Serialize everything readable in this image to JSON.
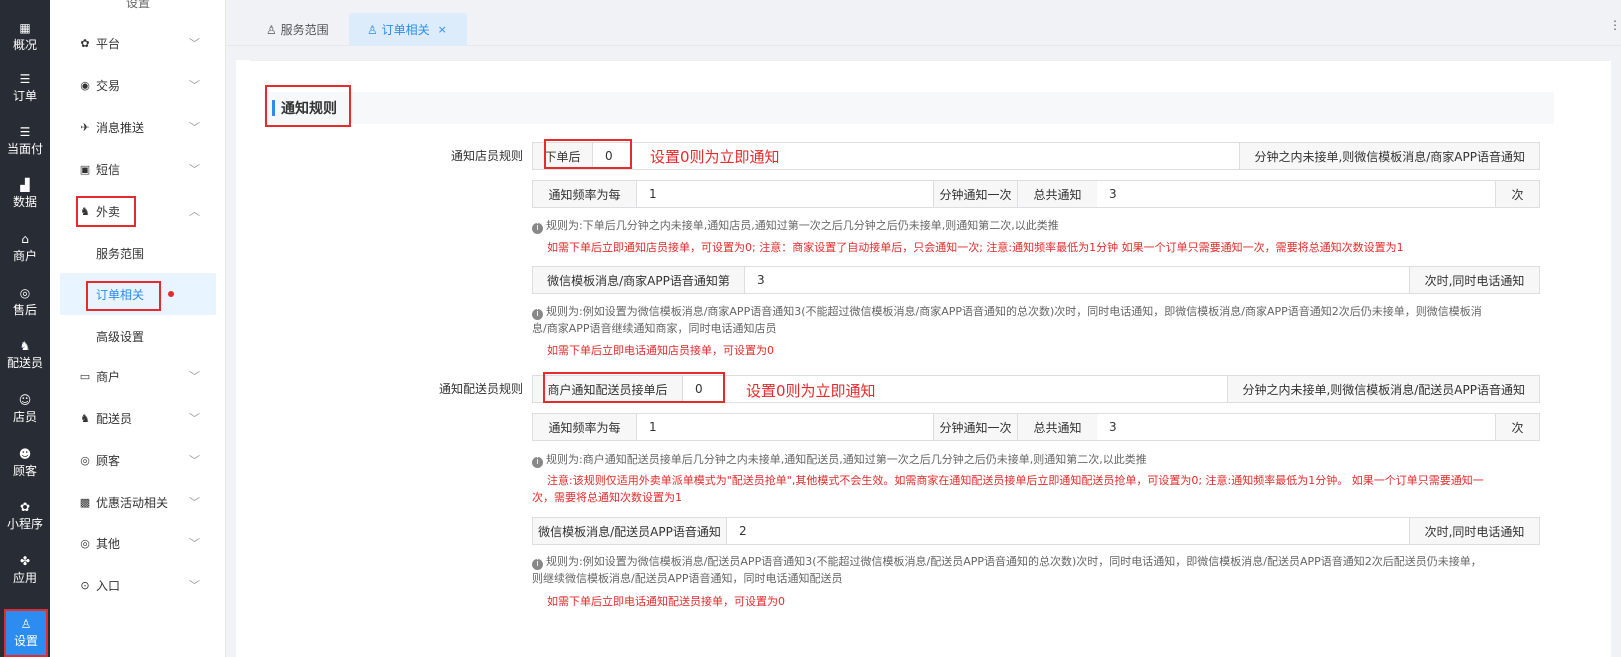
{
  "rail": [
    {
      "icon": "dashboard-icon",
      "glyph": "▦",
      "label": "概况"
    },
    {
      "icon": "list-icon",
      "glyph": "☰",
      "label": "订单"
    },
    {
      "icon": "list-icon",
      "glyph": "☰",
      "label": "当面付"
    },
    {
      "icon": "bar-chart-icon",
      "glyph": "▟",
      "label": "数据"
    },
    {
      "icon": "shop-icon",
      "glyph": "⌂",
      "label": "商户"
    },
    {
      "icon": "headset-icon",
      "glyph": "◎",
      "label": "售后"
    },
    {
      "icon": "scooter-icon",
      "glyph": "♞",
      "label": "配送员"
    },
    {
      "icon": "user-icon",
      "glyph": "☺",
      "label": "店员"
    },
    {
      "icon": "customer-icon",
      "glyph": "☻",
      "label": "顾客"
    },
    {
      "icon": "mini-program-icon",
      "glyph": "✿",
      "label": "小程序"
    },
    {
      "icon": "apps-icon",
      "glyph": "✤",
      "label": "应用"
    },
    {
      "icon": "settings-user-icon",
      "glyph": "♙",
      "label": "设置"
    }
  ],
  "submenu": {
    "title": "设置",
    "items": [
      {
        "icon": "gear-icon",
        "glyph": "✿",
        "label": "平台"
      },
      {
        "icon": "trade-icon",
        "glyph": "◉",
        "label": "交易"
      },
      {
        "icon": "push-icon",
        "glyph": "✈",
        "label": "消息推送"
      },
      {
        "icon": "sms-icon",
        "glyph": "▣",
        "label": "短信"
      },
      {
        "icon": "takeout-icon",
        "glyph": "♞",
        "label": "外卖"
      },
      {
        "icon": "shop-icon",
        "glyph": "▭",
        "label": "商户"
      },
      {
        "icon": "rider-icon",
        "glyph": "♞",
        "label": "配送员"
      },
      {
        "icon": "customer-icon",
        "glyph": "◎",
        "label": "顾客"
      },
      {
        "icon": "gift-icon",
        "glyph": "▩",
        "label": "优惠活动相关"
      },
      {
        "icon": "other-icon",
        "glyph": "◎",
        "label": "其他"
      },
      {
        "icon": "entry-icon",
        "glyph": "⊙",
        "label": "入口"
      }
    ],
    "subitems": [
      "服务范围",
      "订单相关",
      "高级设置"
    ]
  },
  "tabs": [
    {
      "label": "服务范围"
    },
    {
      "label": "订单相关",
      "close": "×"
    }
  ],
  "tabs_more": "⋮",
  "section_title": "通知规则",
  "store": {
    "label": "通知店员规则",
    "after_order": "下单后",
    "after_order_value": "0",
    "annotation": "设置0则为立即通知",
    "after_order_suffix": "分钟之内未接单,则微信模板消息/商家APP语音通知",
    "freq_label": "通知频率为每",
    "freq_value": "1",
    "freq_unit": "分钟通知一次",
    "total_label": "总共通知",
    "total_value": "3",
    "total_unit": "次",
    "rule_note": "规则为:下单后几分钟之内未接单,通知店员,通知过第一次之后几分钟之后仍未接单,则通知第二次,以此类推",
    "warn": "如需下单后立即通知店员接单，可设置为0; 注意：商家设置了自动接单后，只会通知一次; 注意:通知频率最低为1分钟 如果一个订单只需要通知一次，需要将总通知次数设置为1",
    "wx_label": "微信模板消息/商家APP语音通知第",
    "wx_value": "3",
    "wx_unit": "次时,同时电话通知",
    "wx_note_1": "规则为:例如设置为微信模板消息/商家APP语音通知3(不能超过微信模板消息/商家APP语音通知的总次数)次时，同时电话通知，即微信模板消息/商家APP语音通知2次后仍未接单，则微信模板消",
    "wx_note_2": "息/商家APP语音继续通知商家，同时电话通知店员",
    "wx_warn": "如需下单后立即电话通知店员接单，可设置为0"
  },
  "rider": {
    "label": "通知配送员规则",
    "accept_label": "商户通知配送员接单后",
    "accept_value": "0",
    "annotation": "设置0则为立即通知",
    "accept_suffix": "分钟之内未接单,则微信模板消息/配送员APP语音通知",
    "freq_label": "通知频率为每",
    "freq_value": "1",
    "freq_unit": "分钟通知一次",
    "total_label": "总共通知",
    "total_value": "3",
    "total_unit": "次",
    "rule_note": "规则为:商户通知配送员接单后几分钟之内未接单,通知配送员,通知过第一次之后几分钟之后仍未接单,则通知第二次,以此类推",
    "warn_1": "注意:该规则仅适用外卖单派单模式为\"配送员抢单\",其他模式不会生效。如需商家在通知配送员接单后立即通知配送员抢单，可设置为0; 注意:通知频率最低为1分钟。 如果一个订单只需要通知一",
    "warn_2": "次，需要将总通知次数设置为1",
    "wx_label": "微信模板消息/配送员APP语音通知",
    "wx_value": "2",
    "wx_unit": "次时,同时电话通知",
    "wx_note_1": "规则为:例如设置为微信模板消息/配送员APP语音通知3(不能超过微信模板消息/配送员APP语音通知的总次数)次时，同时电话通知，即微信模板消息/配送员APP语音通知2次后配送员仍未接单，",
    "wx_note_2": "则继续微信模板消息/配送员APP语音通知，同时电话通知配送员",
    "wx_warn": "如需下单后立即电话通知配送员接单，可设置为0"
  },
  "info_glyph": "i",
  "chevron_down": "﹀",
  "chevron_up": "︿",
  "colors": {
    "accent": "#2d8cf0",
    "highlight": "#e52b2b",
    "rail": "#282c34"
  }
}
